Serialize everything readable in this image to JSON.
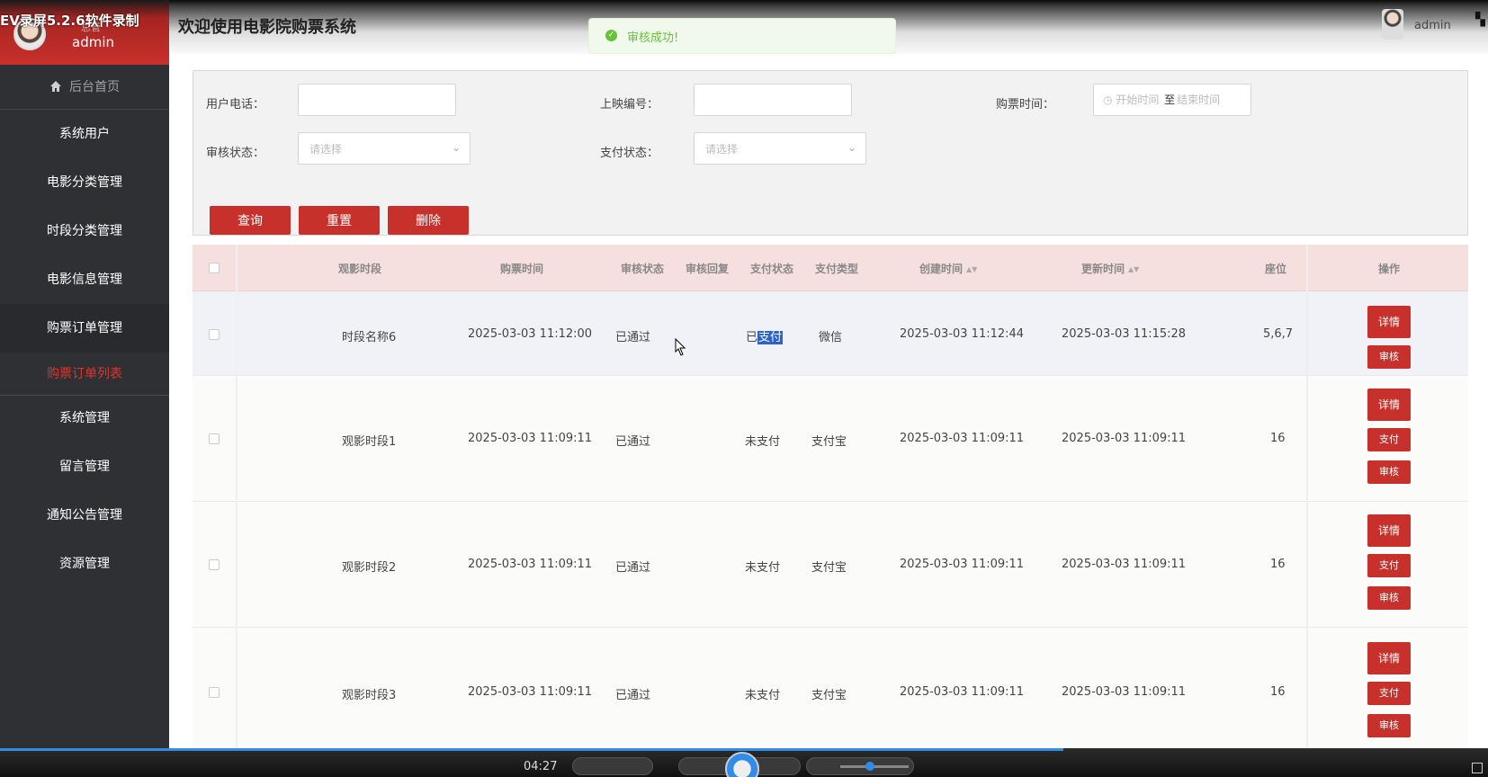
{
  "recorder": {
    "watermark": "EV录屏5.2.6软件录制",
    "time": "04:27"
  },
  "sidebar": {
    "role": "总管",
    "user": "admin",
    "home": "后台首页",
    "items": [
      "系统用户",
      "电影分类管理",
      "时段分类管理",
      "电影信息管理",
      "购票订单管理"
    ],
    "active_sub": "购票订单列表",
    "items2": [
      "系统管理",
      "留言管理",
      "通知公告管理",
      "资源管理"
    ]
  },
  "topbar": {
    "title": "欢迎使用电影院购票系统",
    "user": "admin"
  },
  "toast": {
    "text": "审核成功!"
  },
  "filter": {
    "phone_label": "用户电话：",
    "screening_label": "上映编号：",
    "buy_time_label": "购票时间：",
    "start_placeholder": "开始时间",
    "to": "至",
    "end_placeholder": "结束时间",
    "audit_label": "审核状态：",
    "audit_placeholder": "请选择",
    "pay_label": "支付状态：",
    "pay_placeholder": "请选择",
    "query": "查询",
    "reset": "重置",
    "delete": "删除"
  },
  "table": {
    "headers": {
      "slot": "观影时段",
      "buy_time": "购票时间",
      "audit_status": "审核状态",
      "audit_reply": "审核回复",
      "pay_status": "支付状态",
      "pay_type": "支付类型",
      "created": "创建时间",
      "updated": "更新时间",
      "seat": "座位",
      "ops": "操作"
    },
    "rows": [
      {
        "slot": "时段名称6",
        "buy_time": "2025-03-03 11:12:00",
        "audit_status": "已通过",
        "audit_reply": "",
        "pay_status_pre": "已",
        "pay_status_sel": "支付",
        "pay_type": "微信",
        "created": "2025-03-03 11:12:44",
        "updated": "2025-03-03 11:15:28",
        "seat": "5,6,7",
        "btns": [
          "详情",
          "审核"
        ]
      },
      {
        "slot": "观影时段1",
        "buy_time": "2025-03-03 11:09:11",
        "audit_status": "已通过",
        "audit_reply": "",
        "pay_status": "未支付",
        "pay_type": "支付宝",
        "created": "2025-03-03 11:09:11",
        "updated": "2025-03-03 11:09:11",
        "seat": "16",
        "btns": [
          "详情",
          "支付",
          "审核"
        ]
      },
      {
        "slot": "观影时段2",
        "buy_time": "2025-03-03 11:09:11",
        "audit_status": "已通过",
        "audit_reply": "",
        "pay_status": "未支付",
        "pay_type": "支付宝",
        "created": "2025-03-03 11:09:11",
        "updated": "2025-03-03 11:09:11",
        "seat": "16",
        "btns": [
          "详情",
          "支付",
          "审核"
        ]
      },
      {
        "slot": "观影时段3",
        "buy_time": "2025-03-03 11:09:11",
        "audit_status": "已通过",
        "audit_reply": "",
        "pay_status": "未支付",
        "pay_type": "支付宝",
        "created": "2025-03-03 11:09:11",
        "updated": "2025-03-03 11:09:11",
        "seat": "16",
        "btns": [
          "详情",
          "支付",
          "审核"
        ]
      }
    ]
  },
  "colors": {
    "brand": "#c8312b",
    "sidebar": "#2f3033",
    "header_row": "#f6dfdf",
    "success": "#67c23a"
  }
}
